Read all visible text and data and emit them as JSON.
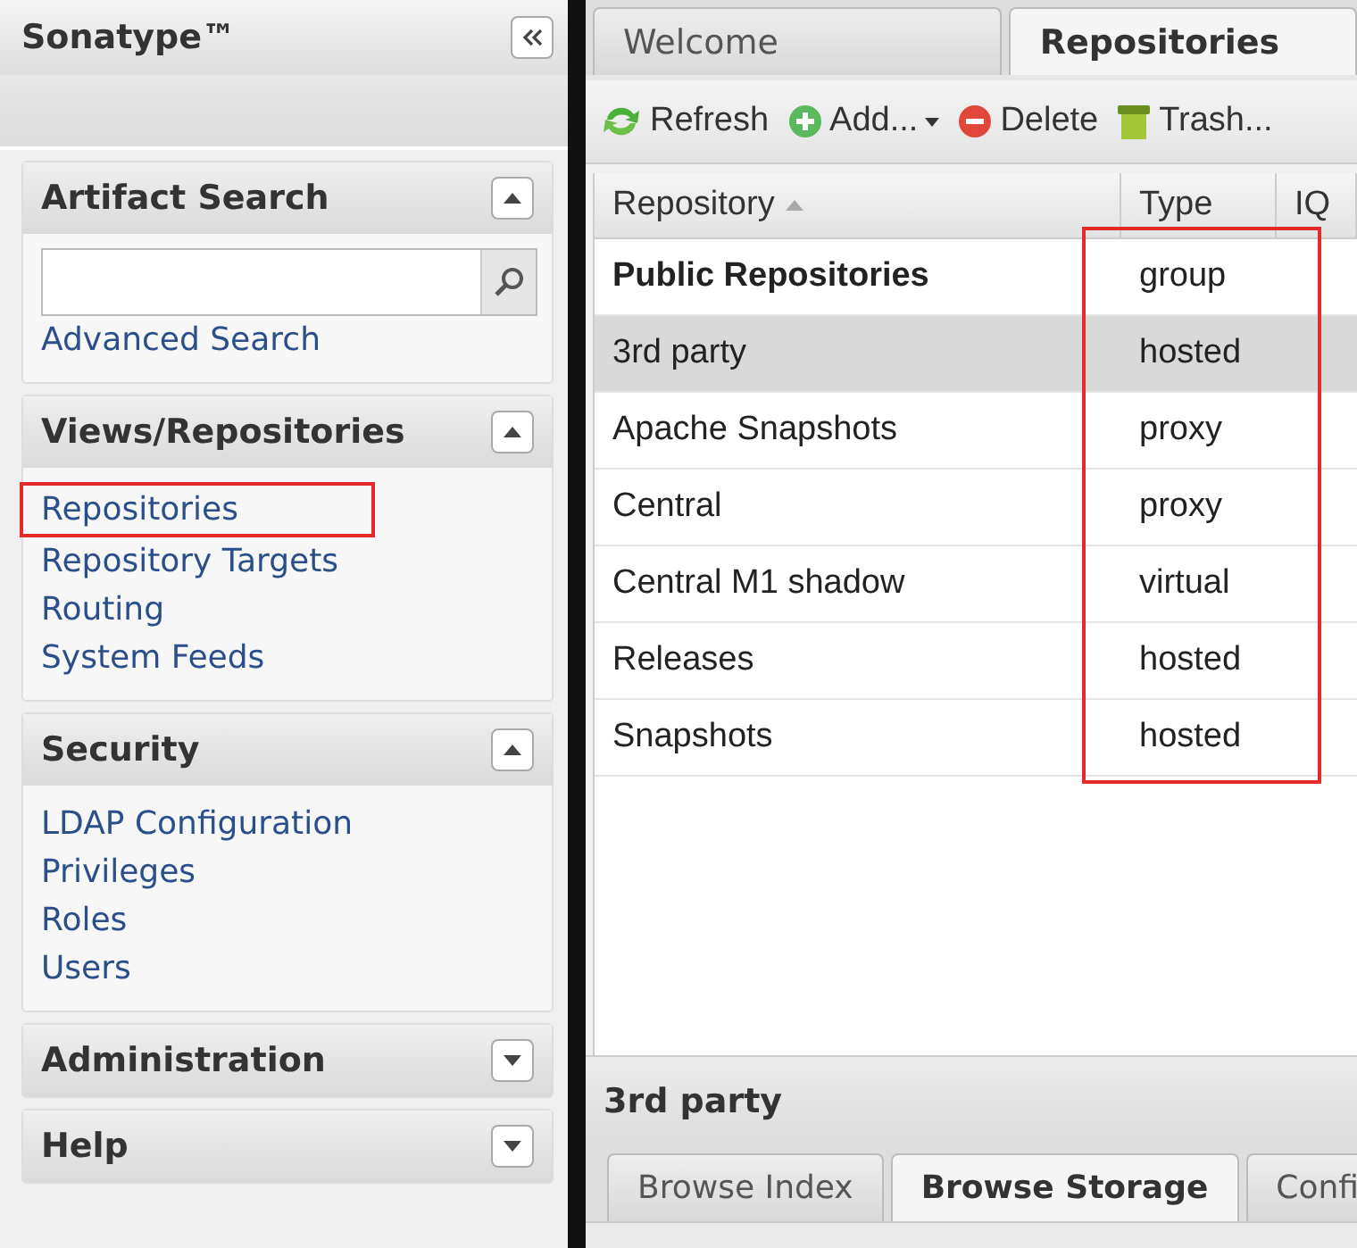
{
  "sidebar": {
    "title": "Sonatype™",
    "sections": [
      {
        "kind": "search",
        "title": "Artifact Search",
        "expanded": true,
        "link": "Advanced Search"
      },
      {
        "kind": "links",
        "title": "Views/Repositories",
        "expanded": true,
        "items": [
          {
            "label": "Repositories",
            "annotated": true
          },
          {
            "label": "Repository Targets",
            "annotated": false
          },
          {
            "label": "Routing",
            "annotated": false
          },
          {
            "label": "System Feeds",
            "annotated": false
          }
        ]
      },
      {
        "kind": "links",
        "title": "Security",
        "expanded": true,
        "items": [
          {
            "label": "LDAP Configuration",
            "annotated": false
          },
          {
            "label": "Privileges",
            "annotated": false
          },
          {
            "label": "Roles",
            "annotated": false
          },
          {
            "label": "Users",
            "annotated": false
          }
        ]
      },
      {
        "title": "Administration",
        "expanded": false
      },
      {
        "title": "Help",
        "expanded": false
      }
    ]
  },
  "tabs": [
    {
      "label": "Welcome",
      "selected": false
    },
    {
      "label": "Repositories",
      "selected": true
    }
  ],
  "toolbar": [
    {
      "kind": "refresh",
      "label": "Refresh"
    },
    {
      "kind": "add",
      "label": "Add...",
      "dropdown": true
    },
    {
      "kind": "delete",
      "label": "Delete"
    },
    {
      "kind": "trash",
      "label": "Trash..."
    }
  ],
  "table": {
    "columns": [
      {
        "label": "Repository",
        "sorted": true,
        "annotated": false
      },
      {
        "label": "Type",
        "sorted": false,
        "annotated": true
      },
      {
        "label": "IQ",
        "sorted": false,
        "annotated": false
      }
    ],
    "rows": [
      {
        "cells": [
          "Public Repositories",
          "group"
        ],
        "emphasized": true,
        "selected": false
      },
      {
        "cells": [
          "3rd party",
          "hosted"
        ],
        "emphasized": false,
        "selected": true
      },
      {
        "cells": [
          "Apache Snapshots",
          "proxy"
        ],
        "emphasized": false,
        "selected": false
      },
      {
        "cells": [
          "Central",
          "proxy"
        ],
        "emphasized": false,
        "selected": false
      },
      {
        "cells": [
          "Central M1 shadow",
          "virtual"
        ],
        "emphasized": false,
        "selected": false
      },
      {
        "cells": [
          "Releases",
          "hosted"
        ],
        "emphasized": false,
        "selected": false
      },
      {
        "cells": [
          "Snapshots",
          "hosted"
        ],
        "emphasized": false,
        "selected": false
      }
    ]
  },
  "detail": {
    "title": "3rd party",
    "tabs": [
      {
        "label": "Browse Index",
        "selected": false
      },
      {
        "label": "Browse Storage",
        "selected": true
      },
      {
        "label": "Confi",
        "selected": false
      }
    ]
  }
}
